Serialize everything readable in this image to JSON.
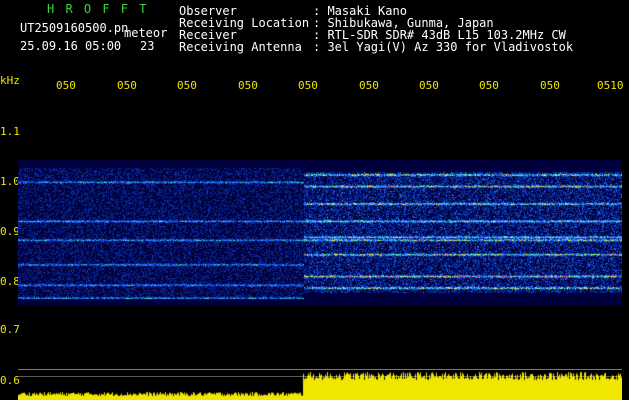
{
  "header": {
    "logo": "H R O F F T",
    "filename": "UT2509160500.pn",
    "meteor_label": "meteor",
    "date_time": "25.09.16 05:00",
    "count": "23",
    "fields": [
      {
        "label": "Observer",
        "value": ": Masaki Kano"
      },
      {
        "label": "Receiving Location",
        "value": ": Shibukawa, Gunma, Japan"
      },
      {
        "label": "Receiver",
        "value": ": RTL-SDR SDR# 43dB L15 103.2MHz CW"
      },
      {
        "label": "Receiving Antenna",
        "value": ": 3el Yagi(V) Az 330 for Vladivostok"
      }
    ]
  },
  "time_axis": {
    "ticks": [
      "050",
      "050",
      "050",
      "050",
      "050",
      "050",
      "050",
      "050",
      "050",
      "0510"
    ]
  },
  "freq_axis": {
    "unit": "kHz",
    "ticks": [
      "1.1",
      "1.0",
      "0.9",
      "0.8",
      "0.7",
      "0.6"
    ]
  },
  "colors": {
    "background": "#000000",
    "spectrogram_bg": "#00003c",
    "text_white": "#ffffff",
    "text_green": "#3cd23c",
    "text_yellow": "#f0e600",
    "level_bar": "#f0e600"
  }
}
